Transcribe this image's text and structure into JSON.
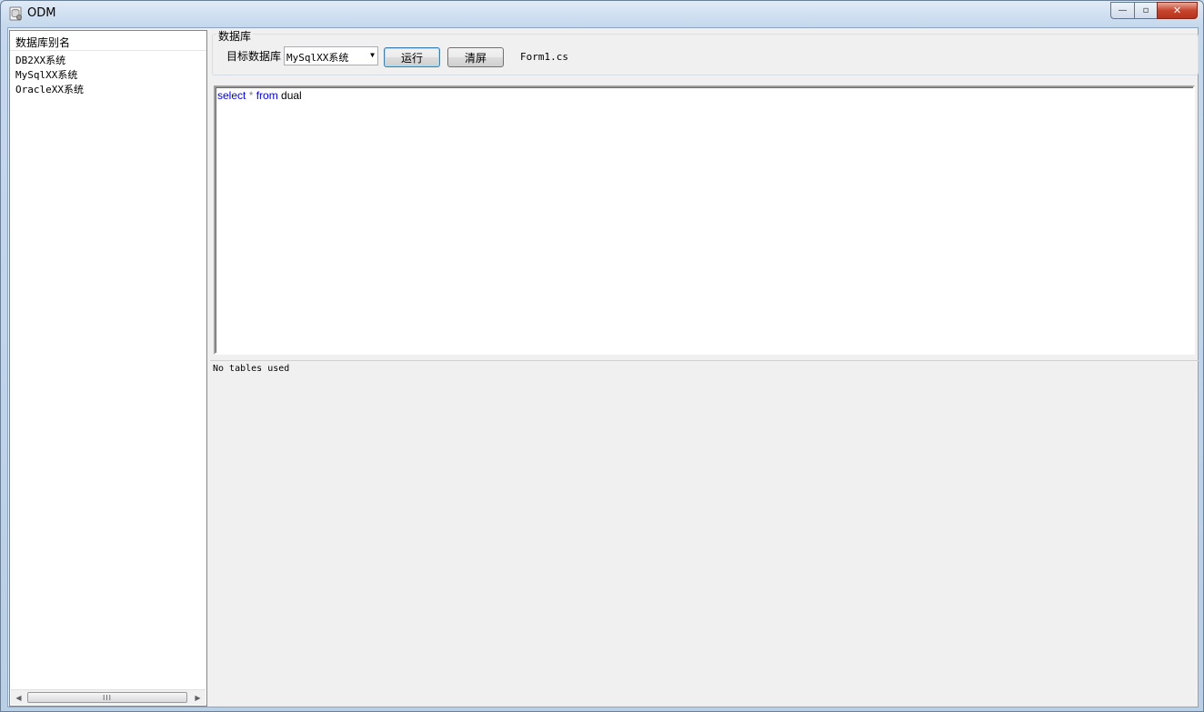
{
  "window": {
    "title": "ODM",
    "minimize_glyph": "—",
    "maximize_glyph": "▫",
    "close_glyph": "✕"
  },
  "left_panel": {
    "header": "数据库别名",
    "items": [
      "DB2XX系统",
      "MySqlXX系统",
      "OracleXX系统"
    ],
    "scroll_grip": "III"
  },
  "toolbar": {
    "group_title": "数据库",
    "target_label": "目标数据库",
    "selected_db": "MySqlXX系统",
    "run_label": "运行",
    "clear_label": "清屏",
    "file_label": "Form1.cs"
  },
  "editor": {
    "tokens": [
      {
        "text": "select",
        "kind": "kw"
      },
      {
        "text": " * ",
        "kind": "op"
      },
      {
        "text": "from",
        "kind": "kw"
      },
      {
        "text": " dual",
        "kind": "plain"
      }
    ]
  },
  "output": {
    "text": "No tables used"
  },
  "colors": {
    "keyword": "#0000ff",
    "operator": "#808080",
    "close_button": "#c8452d"
  }
}
